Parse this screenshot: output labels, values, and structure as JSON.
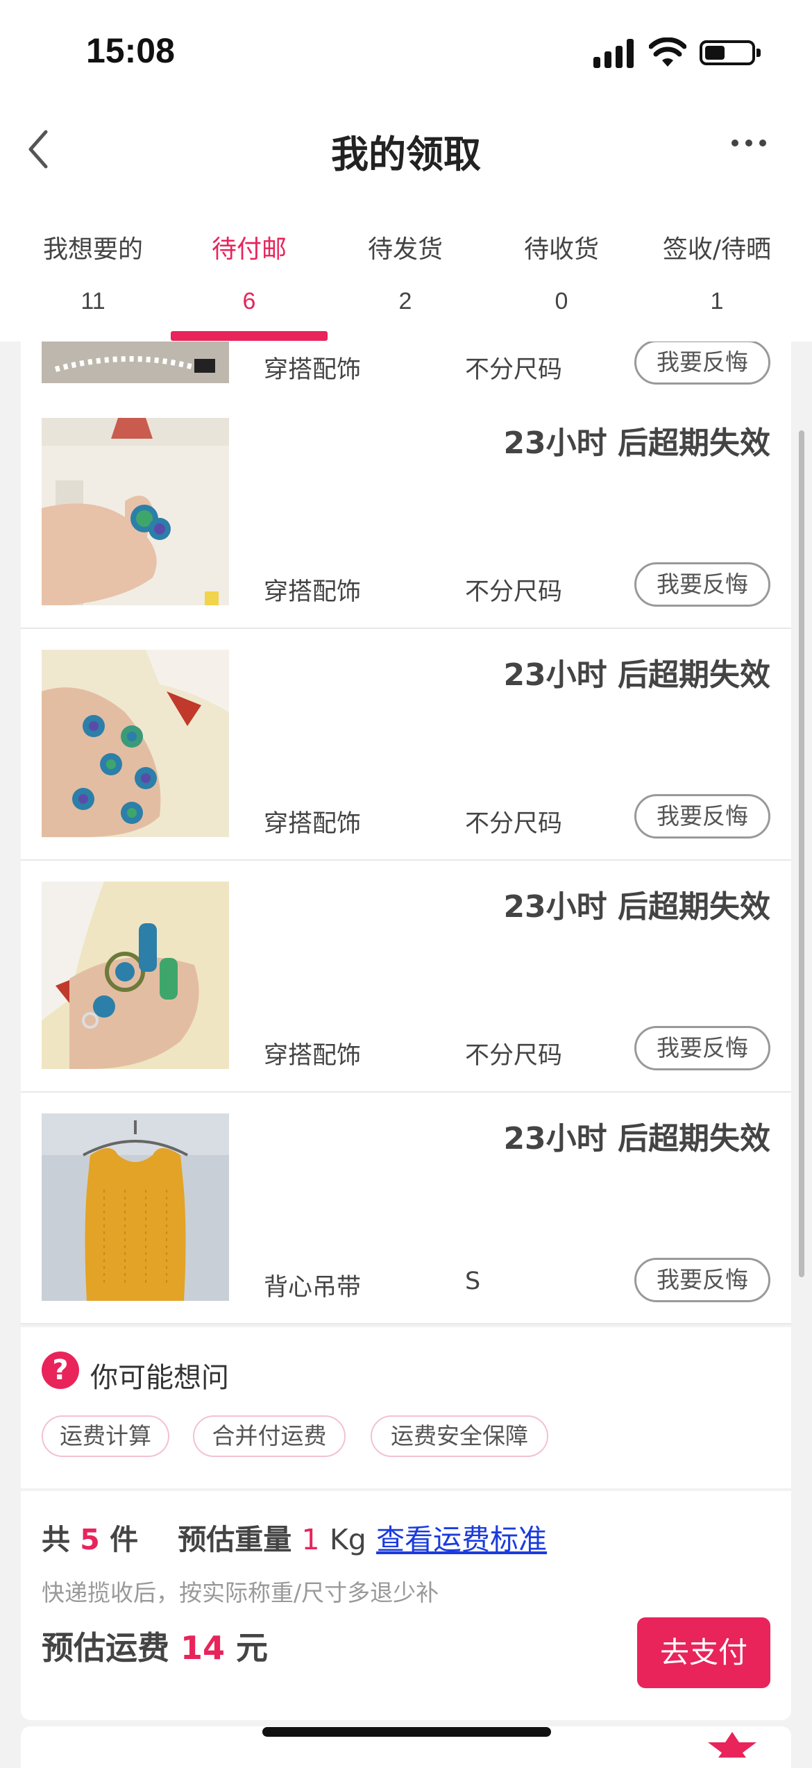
{
  "status_bar": {
    "time": "15:08"
  },
  "nav": {
    "title": "我的领取"
  },
  "tabs": [
    {
      "label": "我想要的",
      "count": "11",
      "active": false
    },
    {
      "label": "待付邮",
      "count": "6",
      "active": true
    },
    {
      "label": "待发货",
      "count": "2",
      "active": false
    },
    {
      "label": "待收货",
      "count": "0",
      "active": false
    },
    {
      "label": "签收/待晒",
      "count": "1",
      "active": false
    }
  ],
  "items": [
    {
      "category": "穿搭配饰",
      "size": "不分尺码",
      "action": "我要反悔"
    },
    {
      "expiry": "23小时 后超期失效",
      "category": "穿搭配饰",
      "size": "不分尺码",
      "action": "我要反悔"
    },
    {
      "expiry": "23小时 后超期失效",
      "category": "穿搭配饰",
      "size": "不分尺码",
      "action": "我要反悔"
    },
    {
      "expiry": "23小时 后超期失效",
      "category": "穿搭配饰",
      "size": "不分尺码",
      "action": "我要反悔"
    },
    {
      "expiry": "23小时 后超期失效",
      "category": "背心吊带",
      "size": "S",
      "action": "我要反悔"
    }
  ],
  "faq": {
    "title": "你可能想问",
    "chips": [
      "运费计算",
      "合并付运费",
      "运费安全保障"
    ]
  },
  "summary": {
    "total_prefix": "共",
    "total_count": "5",
    "total_unit": "件",
    "weight_label": "预估重量",
    "weight_value": "1",
    "weight_unit": "Kg",
    "link": "查看运费标准",
    "note": "快递揽收后，按实际称重/尺寸多退少补",
    "fee_label": "预估运费",
    "fee_value": "14",
    "fee_unit": "元",
    "pay_button": "去支付"
  },
  "colors": {
    "accent": "#e8245b",
    "link": "#1a3be0"
  }
}
